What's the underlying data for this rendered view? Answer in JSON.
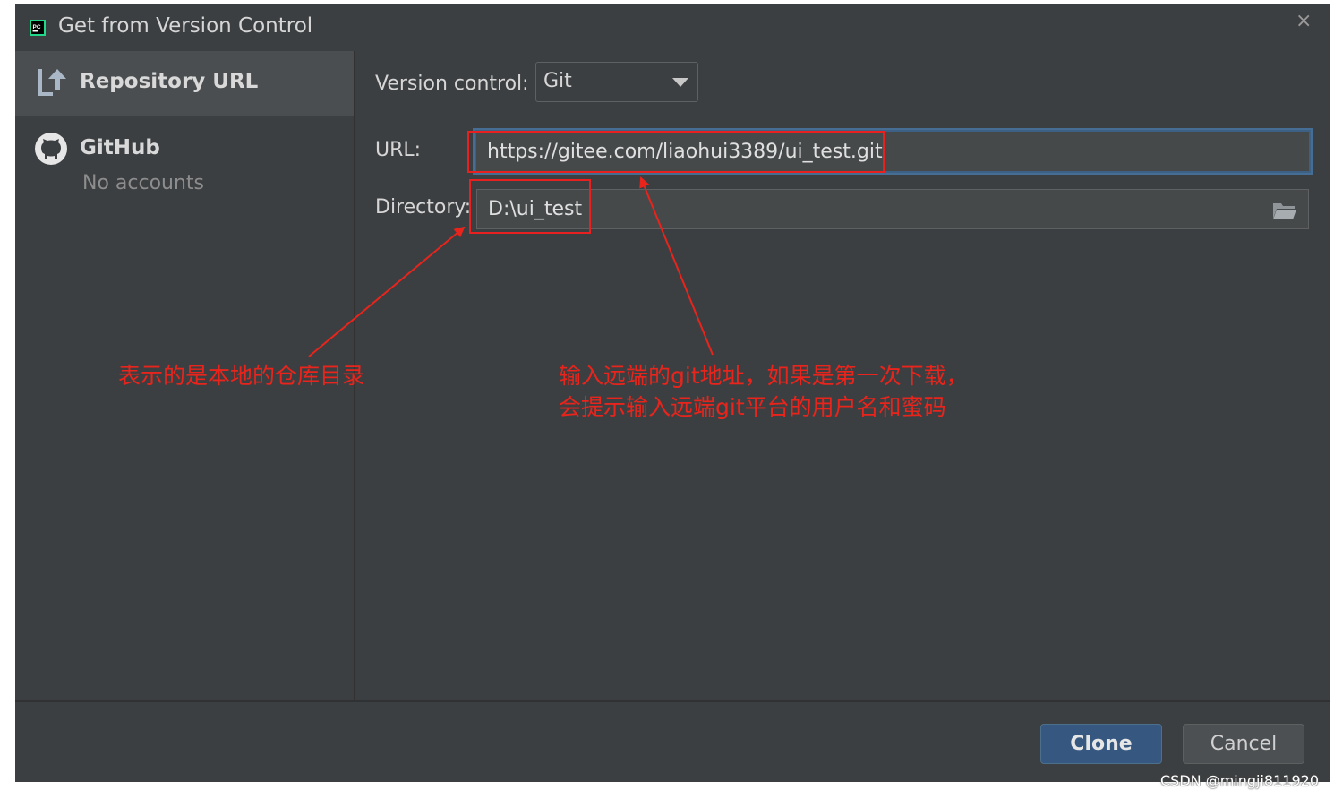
{
  "window": {
    "title": "Get from Version Control",
    "close_glyph": "×"
  },
  "sidebar": {
    "items": [
      {
        "label": "Repository URL",
        "icon": "vcs-push-icon",
        "selected": true
      },
      {
        "label": "GitHub",
        "sublabel": "No accounts",
        "icon": "github-icon"
      }
    ]
  },
  "form": {
    "version_control_label": "Version control:",
    "version_control_value": "Git",
    "url_label": "URL:",
    "url_value": "https://gitee.com/liaohui3389/ui_test.git",
    "directory_label": "Directory:",
    "directory_value": "D:\\ui_test"
  },
  "buttons": {
    "clone": "Clone",
    "cancel": "Cancel"
  },
  "annotations": {
    "directory_note": "表示的是本地的仓库目录",
    "url_note_line1": "输入远端的git地址，如果是第一次下载，",
    "url_note_line2": "会提示输入远端git平台的用户名和蜜码",
    "color": "#e8241c"
  },
  "watermark": "CSDN @mingji811920",
  "colors": {
    "background": "#3c3f41",
    "accent": "#365880",
    "focus_border": "#466d94"
  }
}
